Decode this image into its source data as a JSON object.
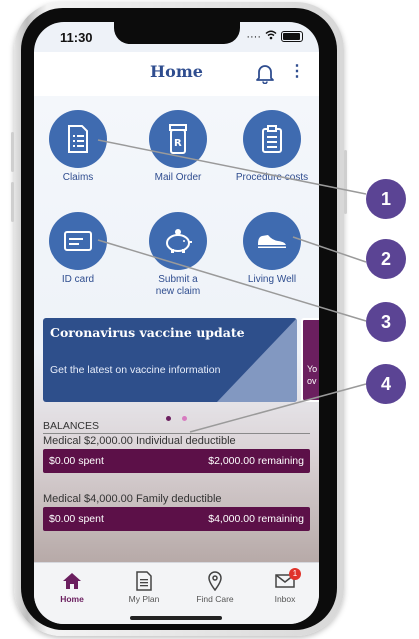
{
  "status_bar": {
    "time": "11:30"
  },
  "header": {
    "title": "Home",
    "bell_icon": "bell-icon",
    "more_icon": "more-vertical-icon"
  },
  "tiles": [
    {
      "label": "Claims",
      "icon": "document-list-icon"
    },
    {
      "label": "Mail Order",
      "icon": "prescription-bottle-icon"
    },
    {
      "label": "Procedure costs",
      "icon": "clipboard-icon"
    },
    {
      "label": "ID card",
      "icon": "id-card-icon"
    },
    {
      "label": "Submit a new claim",
      "icon": "piggy-bank-icon"
    },
    {
      "label": "Living Well",
      "icon": "sneaker-icon"
    }
  ],
  "banner": {
    "headline": "Coronavirus vaccine update",
    "subtext": "Get the latest on vaccine information",
    "next_peek": "Yo ov"
  },
  "carousel": {
    "active_index": 0,
    "count": 2
  },
  "balances": {
    "title": "BALANCES",
    "items": [
      {
        "caption": "Medical $2,000.00 Individual deductible",
        "spent": "$0.00 spent",
        "remaining": "$2,000.00 remaining"
      },
      {
        "caption": "Medical $4,000.00 Family deductible",
        "spent": "$0.00 spent",
        "remaining": "$4,000.00 remaining"
      }
    ]
  },
  "tabs": [
    {
      "label": "Home",
      "icon": "home-icon",
      "active": true
    },
    {
      "label": "My Plan",
      "icon": "document-icon"
    },
    {
      "label": "Find Care",
      "icon": "location-pin-icon"
    },
    {
      "label": "Inbox",
      "icon": "mail-icon",
      "badge": "1"
    }
  ],
  "callouts": [
    "1",
    "2",
    "3",
    "4"
  ],
  "colors": {
    "brand_blue": "#3f6bb0",
    "title_blue": "#2f4d8f",
    "plum": "#5c1048",
    "callout": "#5b4494"
  }
}
